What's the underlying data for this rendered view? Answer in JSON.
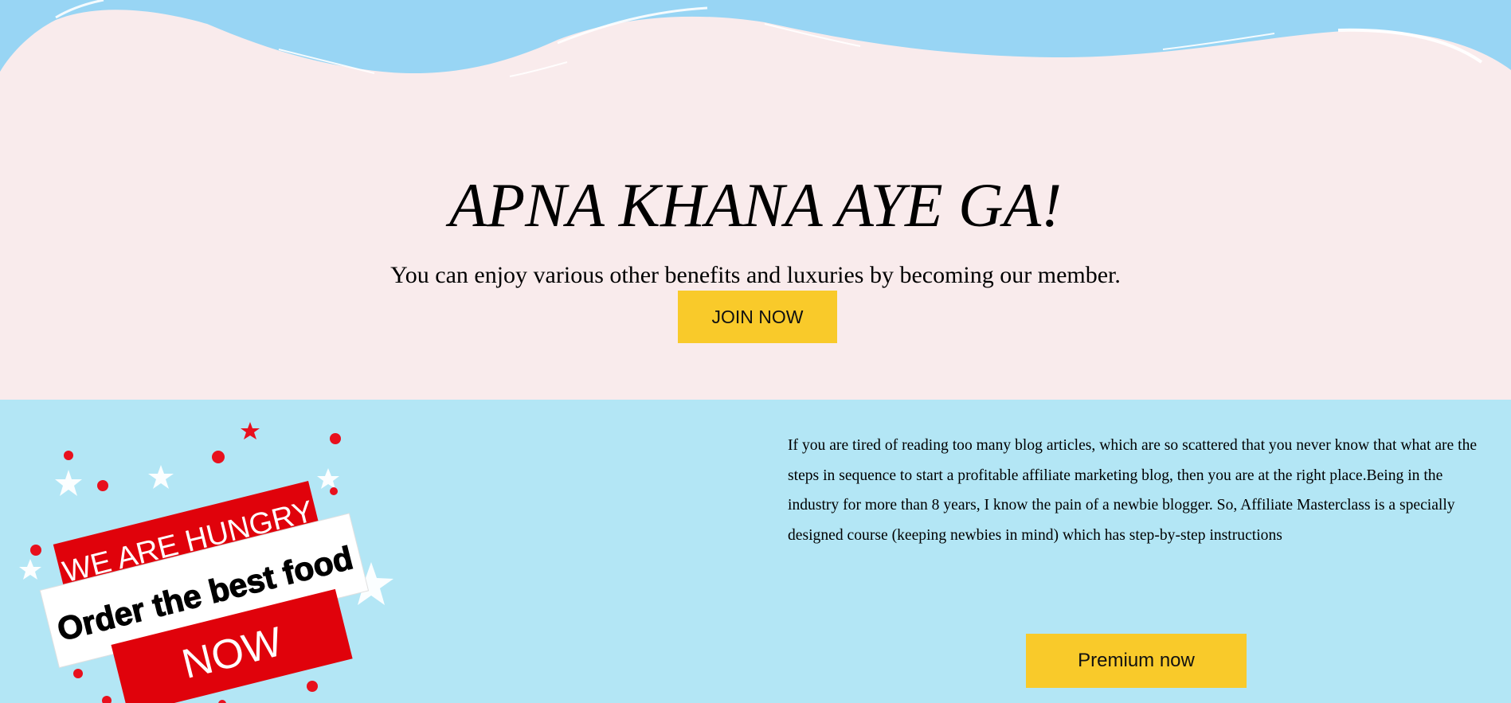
{
  "colors": {
    "hero_background": "#f9ebec",
    "wave_blue": "#98d5f4",
    "promo_background": "#b3e6f5",
    "button_yellow": "#f9ca2a",
    "banner_red": "#e0020b",
    "confetti_red": "#e8101d"
  },
  "hero": {
    "title": "APNA KHANA AYE GA!",
    "subtitle": "You can enjoy various other benefits and luxuries by becoming our member.",
    "join_label": "JOIN NOW"
  },
  "promo": {
    "graphic": {
      "line1": "WE ARE HUNGRY",
      "line2": "Order the best food",
      "line3": "NOW"
    },
    "description": "If you are tired of reading too many blog articles, which are so scattered that you never know that what are the steps in sequence to start a profitable affiliate marketing blog, then you are at the right place.Being in the industry for more than 8 years, I know the pain of a newbie blogger. So, Affiliate Masterclass is a specially designed course (keeping newbies in mind) which has step-by-step instructions",
    "premium_label": "Premium now"
  }
}
